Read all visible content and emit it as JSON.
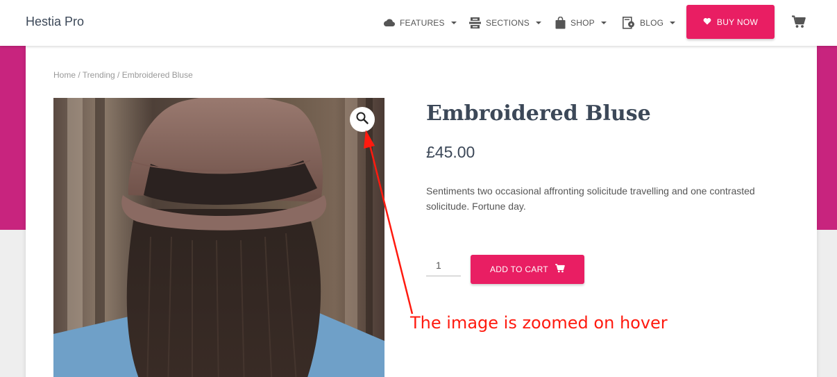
{
  "brand": "Hestia Pro",
  "nav": {
    "items": [
      {
        "label": "FEATURES",
        "icon": "cloud-icon"
      },
      {
        "label": "SECTIONS",
        "icon": "sections-icon"
      },
      {
        "label": "SHOP",
        "icon": "shopping-bag-icon"
      },
      {
        "label": "BLOG",
        "icon": "blog-icon"
      }
    ],
    "buy_now": "BUY NOW",
    "buy_now_icon": "heart-icon",
    "cart_icon": "cart-icon"
  },
  "breadcrumb": "Home / Trending / Embroidered Bluse",
  "product": {
    "title": "Embroidered Bluse",
    "price": "£45.00",
    "description": "Sentiments two occasional affronting solicitude travelling and one contrasted solicitude. Fortune day.",
    "quantity": "1",
    "add_to_cart": "ADD TO CART",
    "zoom_icon": "magnifier-icon"
  },
  "annotation": "The image is zoomed on hover",
  "colors": {
    "accent": "#e91e63",
    "band": "#c8247e",
    "annotation": "#ff1a0f",
    "heading": "#3c4858"
  }
}
